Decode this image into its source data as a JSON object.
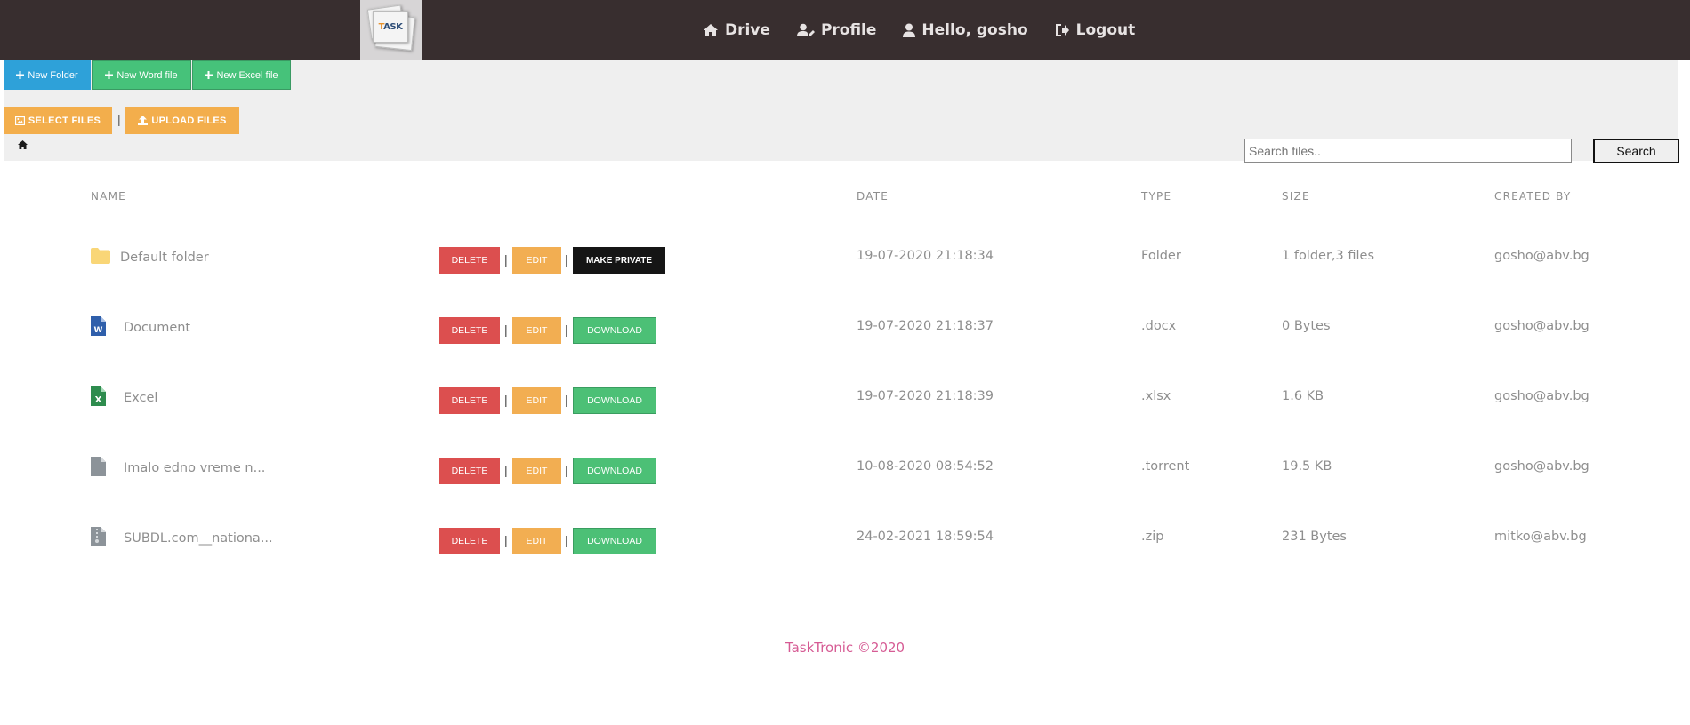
{
  "header": {
    "logo_text": "TASK",
    "nav": [
      {
        "label": "Drive",
        "icon": "home-icon"
      },
      {
        "label": "Profile",
        "icon": "user-edit-icon"
      },
      {
        "label": "Hello, gosho",
        "icon": "user-icon"
      },
      {
        "label": "Logout",
        "icon": "logout-icon"
      }
    ]
  },
  "toolbar": {
    "new_folder": "New Folder",
    "new_word": "New Word file",
    "new_excel": "New Excel file",
    "select_files": "SELECT FILES",
    "separator": "|",
    "upload_files": "UPLOAD FILES"
  },
  "search": {
    "placeholder": "Search files..",
    "button": "Search"
  },
  "table": {
    "columns": {
      "name": "NAME",
      "date": "DATE",
      "type": "TYPE",
      "size": "SIZE",
      "created_by": "CREATED BY"
    },
    "actions": {
      "delete": "DELETE",
      "edit": "EDIT",
      "make_private": "MAKE PRIVATE",
      "download": "DOWNLOAD",
      "pipe": "|"
    },
    "rows": [
      {
        "name": "Default folder",
        "icon": "folder-icon",
        "date": "19-07-2020 21:18:34",
        "type": "Folder",
        "size": "1 folder,3 files",
        "created_by": "gosho@abv.bg"
      },
      {
        "name": "Document",
        "icon": "word-file-icon",
        "date": "19-07-2020 21:18:37",
        "type": ".docx",
        "size": "0 Bytes",
        "created_by": "gosho@abv.bg"
      },
      {
        "name": "Excel",
        "icon": "excel-file-icon",
        "date": "19-07-2020 21:18:39",
        "type": ".xlsx",
        "size": "1.6 KB",
        "created_by": "gosho@abv.bg"
      },
      {
        "name": "Imalo edno vreme n...",
        "icon": "file-icon",
        "date": "10-08-2020 08:54:52",
        "type": ".torrent",
        "size": "19.5 KB",
        "created_by": "gosho@abv.bg"
      },
      {
        "name": "SUBDL.com__nationa...",
        "icon": "zip-file-icon",
        "date": "24-02-2021 18:59:54",
        "type": ".zip",
        "size": "231 Bytes",
        "created_by": "mitko@abv.bg"
      }
    ]
  },
  "footer": {
    "text": "TaskTronic ©2020"
  },
  "colors": {
    "navbar": "#382e2f",
    "primary": "#2ea1d9",
    "success": "#46c27a",
    "warning": "#f3ae4c",
    "danger": "#dc4f4f",
    "dark": "#151515",
    "footer_text": "#d65b94"
  }
}
